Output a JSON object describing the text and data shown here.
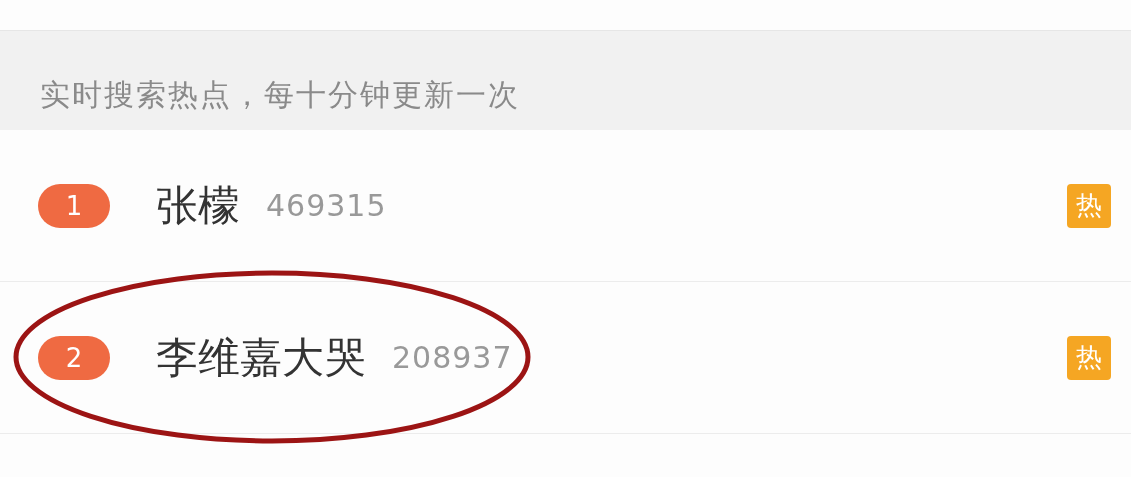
{
  "header": {
    "text": "实时搜索热点，每十分钟更新一次"
  },
  "items": [
    {
      "rank": "1",
      "title": "张檬",
      "count": "469315",
      "tag": "热"
    },
    {
      "rank": "2",
      "title": "李维嘉大哭",
      "count": "208937",
      "tag": "热"
    }
  ],
  "annotation": {
    "kind": "ellipse"
  }
}
